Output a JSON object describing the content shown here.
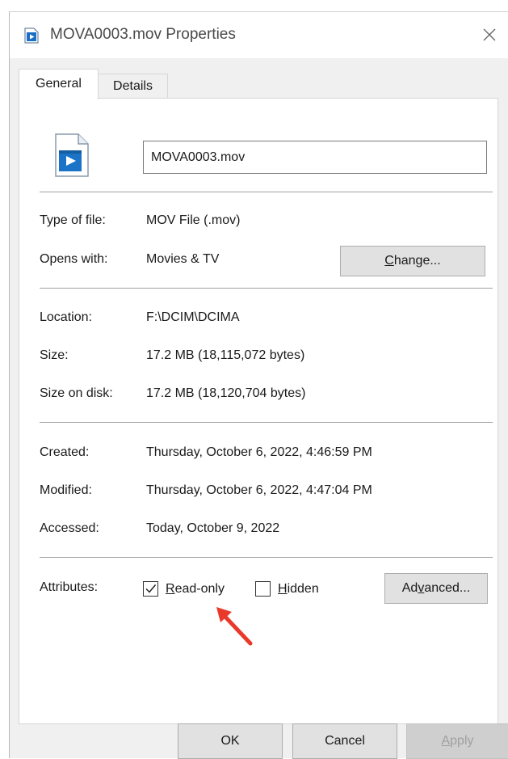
{
  "window": {
    "title": "MOVA0003.mov Properties",
    "close_icon": "close-icon"
  },
  "tabs": [
    {
      "label": "General",
      "active": true
    },
    {
      "label": "Details",
      "active": false
    }
  ],
  "general": {
    "file_name": "MOVA0003.mov",
    "type_of_file_label": "Type of file:",
    "type_of_file_value": "MOV File (.mov)",
    "opens_with_label": "Opens with:",
    "opens_with_value": "Movies & TV",
    "change_button": {
      "prefix": "",
      "accel": "C",
      "suffix": "hange..."
    },
    "location_label": "Location:",
    "location_value": "F:\\DCIM\\DCIMA",
    "size_label": "Size:",
    "size_value": "17.2 MB (18,115,072 bytes)",
    "size_on_disk_label": "Size on disk:",
    "size_on_disk_value": "17.2 MB (18,120,704 bytes)",
    "created_label": "Created:",
    "created_value": "Thursday, October 6, 2022, 4:46:59 PM",
    "modified_label": "Modified:",
    "modified_value": "Thursday, October 6, 2022, 4:47:04 PM",
    "accessed_label": "Accessed:",
    "accessed_value": "Today, October 9, 2022",
    "attributes_label": "Attributes:",
    "readonly": {
      "accel": "R",
      "rest": "ead-only",
      "checked": true
    },
    "hidden": {
      "accel": "H",
      "rest": "idden",
      "checked": false
    },
    "advanced_button": {
      "prefix": "Ad",
      "accel": "v",
      "suffix": "anced..."
    }
  },
  "footer": {
    "ok_label": "OK",
    "cancel_label": "Cancel",
    "apply_button": {
      "prefix": "",
      "accel": "A",
      "suffix": "pply"
    }
  },
  "colors": {
    "annotation_arrow": "#e8392b",
    "icon_blue": "#1a73c7"
  }
}
